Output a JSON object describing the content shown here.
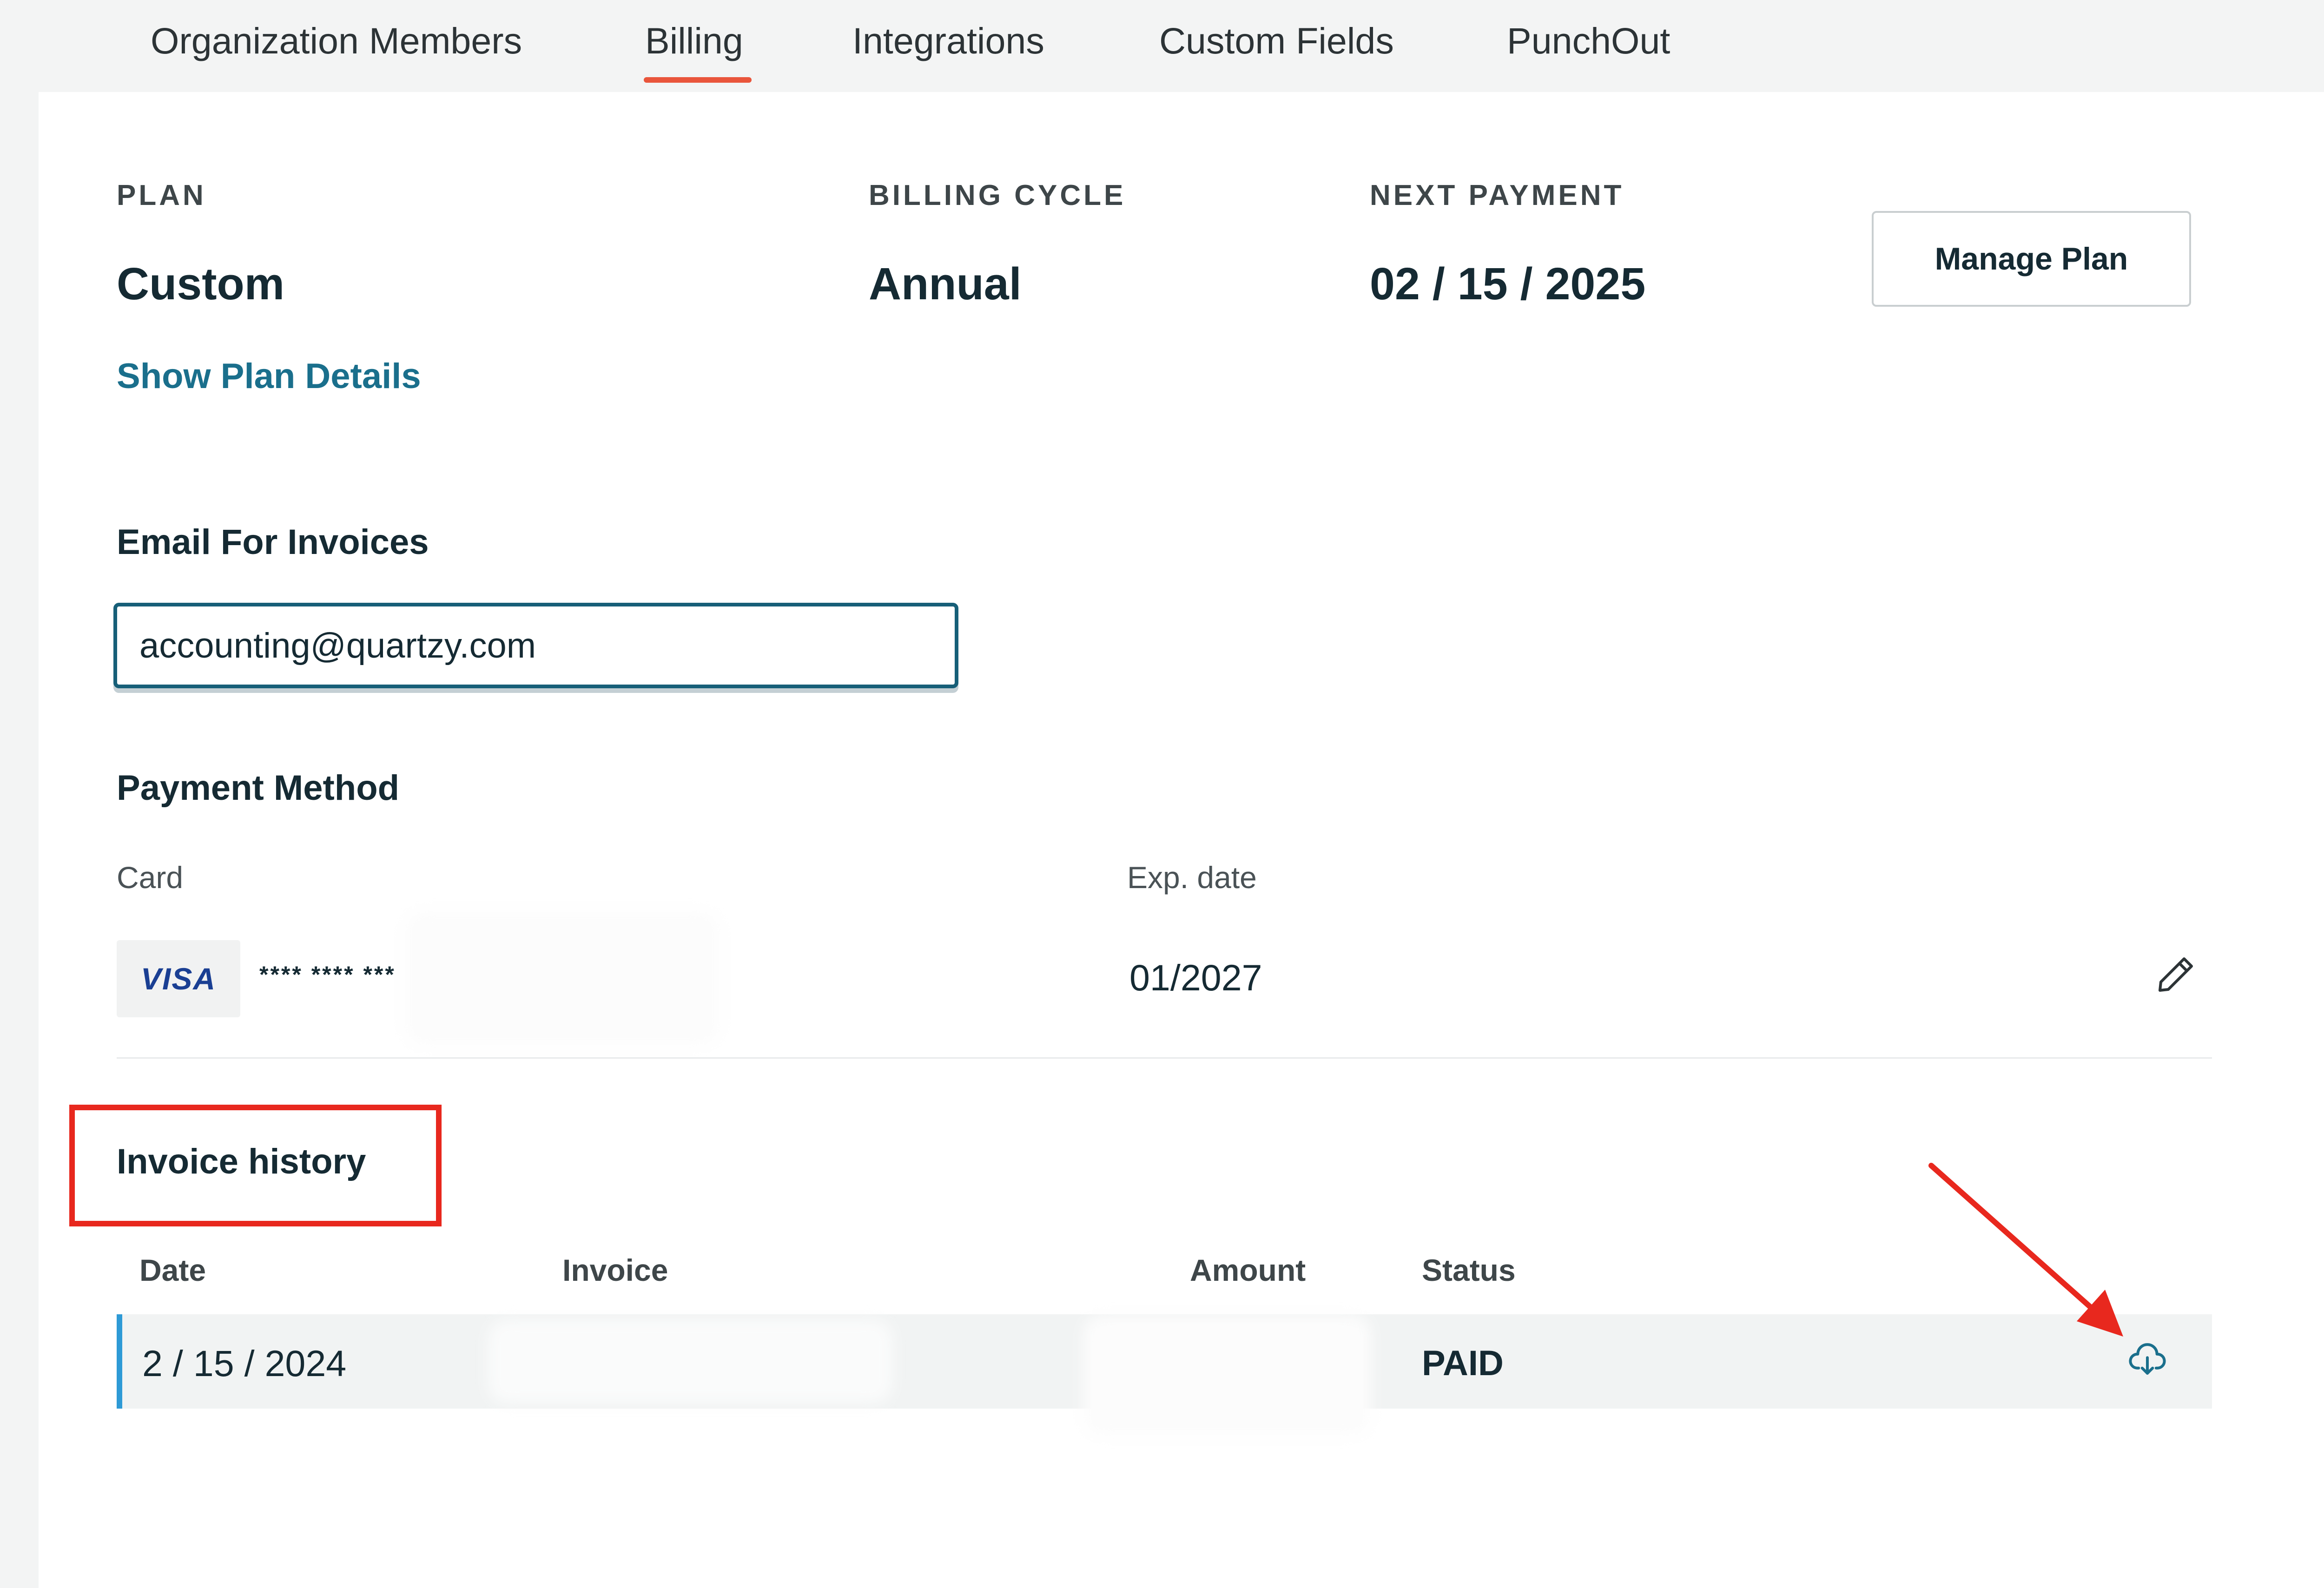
{
  "tabs": [
    {
      "label": "Organization Members"
    },
    {
      "label": "Billing"
    },
    {
      "label": "Integrations"
    },
    {
      "label": "Custom Fields"
    },
    {
      "label": "PunchOut"
    }
  ],
  "active_tab": "Billing",
  "plan": {
    "label": "PLAN",
    "value": "Custom",
    "details_link": "Show Plan Details"
  },
  "billing_cycle": {
    "label": "BILLING CYCLE",
    "value": "Annual"
  },
  "next_payment": {
    "label": "NEXT PAYMENT",
    "value": "02 / 15 / 2025"
  },
  "manage_plan_label": "Manage Plan",
  "email": {
    "title": "Email For Invoices",
    "value": "accounting@quartzy.com"
  },
  "payment_method": {
    "title": "Payment Method",
    "card_label": "Card",
    "exp_label": "Exp. date",
    "card_brand": "VISA",
    "card_masked": "**** **** ***",
    "exp_value": "01/2027"
  },
  "invoice_history": {
    "title": "Invoice history",
    "columns": {
      "date": "Date",
      "invoice": "Invoice",
      "amount": "Amount",
      "status": "Status"
    },
    "rows": [
      {
        "date": "2 / 15 / 2024",
        "status": "PAID"
      }
    ]
  },
  "icons": {
    "edit": "pencil-icon",
    "download": "cloud-download-icon"
  },
  "colors": {
    "accent_tab": "#e9553b",
    "link": "#1a6f8c",
    "row_accent": "#2e9ad6",
    "annotation": "#e8281e"
  }
}
